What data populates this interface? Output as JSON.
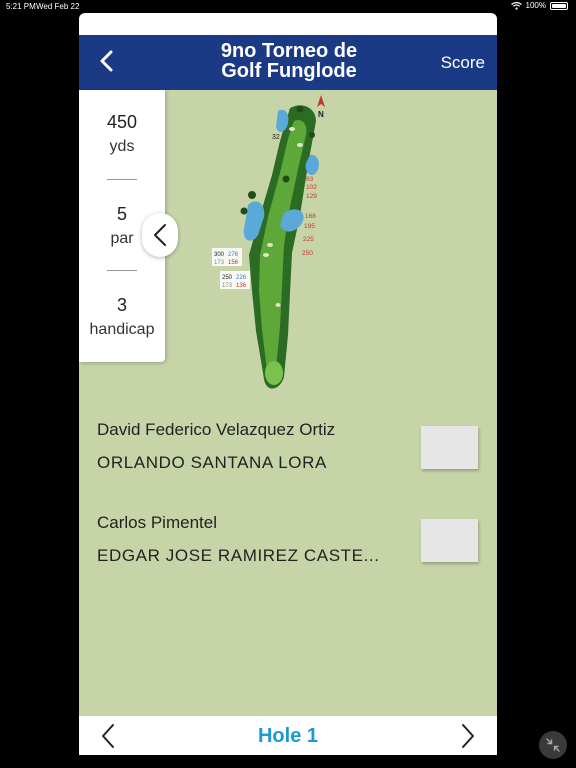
{
  "status_bar": {
    "time": "5:21 PM",
    "date": "Wed Feb 22",
    "battery": "100%"
  },
  "header": {
    "title_line1": "9no Torneo de",
    "title_line2": "Golf Funglode",
    "score_label": "Score"
  },
  "hole_info": {
    "distance": "450",
    "distance_unit": "yds",
    "par": "5",
    "par_label": "par",
    "handicap": "3",
    "handicap_label": "handicap"
  },
  "map_labels": {
    "green_left": "32",
    "distances_right": [
      "83",
      "102",
      "129",
      "168",
      "195",
      "225",
      "250"
    ],
    "left_block1": [
      "300",
      "276",
      "173",
      "156"
    ],
    "left_block2": [
      "250",
      "226",
      "173",
      "136"
    ],
    "compass": "N"
  },
  "groups": [
    {
      "players": [
        "David Federico Velazquez Ortiz",
        "ORLANDO  SANTANA LORA"
      ]
    },
    {
      "players": [
        "Carlos Pimentel",
        "EDGAR JOSE RAMIREZ CASTE..."
      ]
    }
  ],
  "footer": {
    "hole_label": "Hole 1"
  },
  "colors": {
    "header_bg": "#1b3a86",
    "course_bg": "#c7d4a8",
    "hole_label": "#1a9ad6",
    "fairway": "#3f8a2e",
    "water": "#5aa9d8"
  },
  "icons": [
    "back-chevron-icon",
    "collapse-chevron-icon",
    "prev-chevron-icon",
    "next-chevron-icon",
    "wifi-icon",
    "battery-icon",
    "minimize-icon",
    "compass-icon"
  ]
}
